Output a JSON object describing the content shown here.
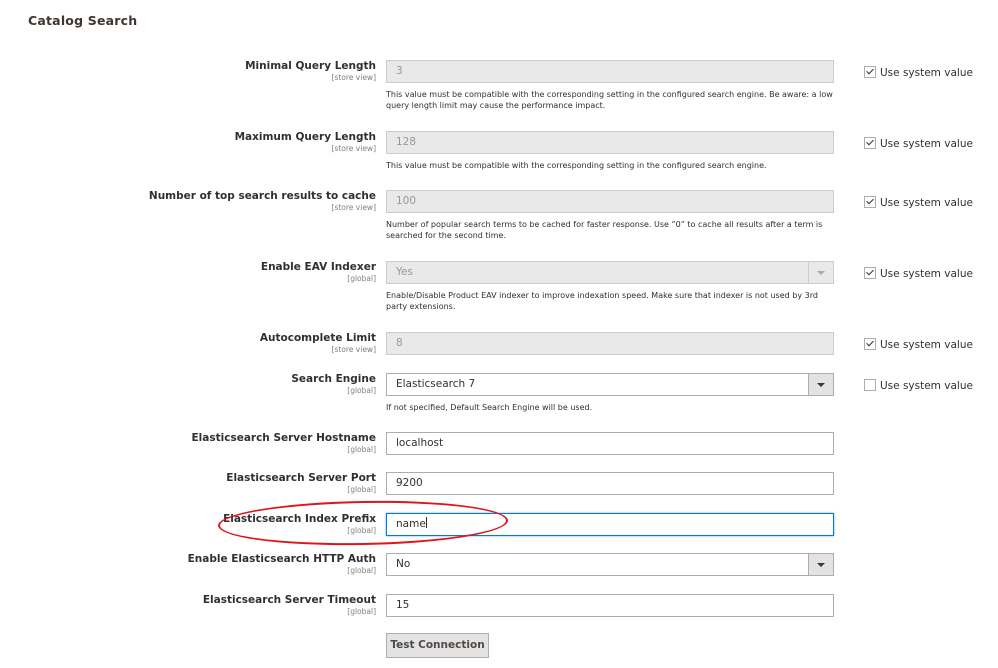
{
  "section_title": "Catalog Search",
  "use_system_value_label": "Use system value",
  "fields": {
    "min_query_length": {
      "label": "Minimal Query Length",
      "scope": "[store view]",
      "value": "3",
      "note": "This value must be compatible with the corresponding setting in the configured search engine. Be aware: a low query length limit may cause the performance impact.",
      "use_system": true
    },
    "max_query_length": {
      "label": "Maximum Query Length",
      "scope": "[store view]",
      "value": "128",
      "note": "This value must be compatible with the corresponding setting in the configured search engine.",
      "use_system": true
    },
    "top_results_cache": {
      "label": "Number of top search results to cache",
      "scope": "[store view]",
      "value": "100",
      "note": "Number of popular search terms to be cached for faster response. Use “0” to cache all results after a term is searched for the second time.",
      "use_system": true
    },
    "eav_indexer": {
      "label": "Enable EAV Indexer",
      "scope": "[global]",
      "value": "Yes",
      "note": "Enable/Disable Product EAV indexer to improve indexation speed. Make sure that indexer is not used by 3rd party extensions.",
      "use_system": true
    },
    "autocomplete_limit": {
      "label": "Autocomplete Limit",
      "scope": "[store view]",
      "value": "8",
      "use_system": true
    },
    "search_engine": {
      "label": "Search Engine",
      "scope": "[global]",
      "value": "Elasticsearch 7",
      "note": "If not specified, Default Search Engine will be used.",
      "use_system": false
    },
    "es_hostname": {
      "label": "Elasticsearch Server Hostname",
      "scope": "[global]",
      "value": "localhost"
    },
    "es_port": {
      "label": "Elasticsearch Server Port",
      "scope": "[global]",
      "value": "9200"
    },
    "es_index_prefix": {
      "label": "Elasticsearch Index Prefix",
      "scope": "[global]",
      "value": "name"
    },
    "es_http_auth": {
      "label": "Enable Elasticsearch HTTP Auth",
      "scope": "[global]",
      "value": "No"
    },
    "es_timeout": {
      "label": "Elasticsearch Server Timeout",
      "scope": "[global]",
      "value": "15"
    }
  },
  "test_connection_label": "Test Connection",
  "colors": {
    "highlight": "#e0141b",
    "focus_border": "#007bdb"
  }
}
